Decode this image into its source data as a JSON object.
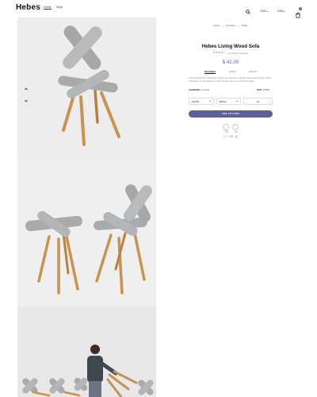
{
  "brand": "Hebes",
  "nav": [
    "Home",
    "Shop"
  ],
  "header_right": {
    "currency": "USD",
    "language": "ENG",
    "cart_count": "0"
  },
  "breadcrumb": [
    "Home",
    "Furniture",
    "Sofas"
  ],
  "product": {
    "title": "Hebes Living Wood Sofa",
    "rating_stars": 5,
    "rating_filled": 4,
    "reviews": "(2 Customer Review)",
    "price": "$ 42.00",
    "tabs": [
      "Description",
      "Details",
      "Reviews"
    ],
    "description": "Fusce eleifend arcu, finibus sit, ultricies vel, elementum feugiat, libero sapien dictum. Donec sollicitudin nisi, quis lobortis id nunc pulvinar. Sed non velit rhoncus felis.",
    "availability_label": "Availability:",
    "availability_value": "In stock",
    "sku_label": "SKU:",
    "sku_value": "D3546",
    "color_option": "WHITE",
    "size_option": "SMALL",
    "quantity": "01",
    "add_to_cart": "ADD TO CART",
    "share": [
      "f",
      "t",
      "G+",
      "p"
    ]
  },
  "colors": {
    "accent": "#5b5f9c",
    "star": "#e0553a",
    "wood": "#c9924f",
    "felt": "#a9aaac"
  }
}
